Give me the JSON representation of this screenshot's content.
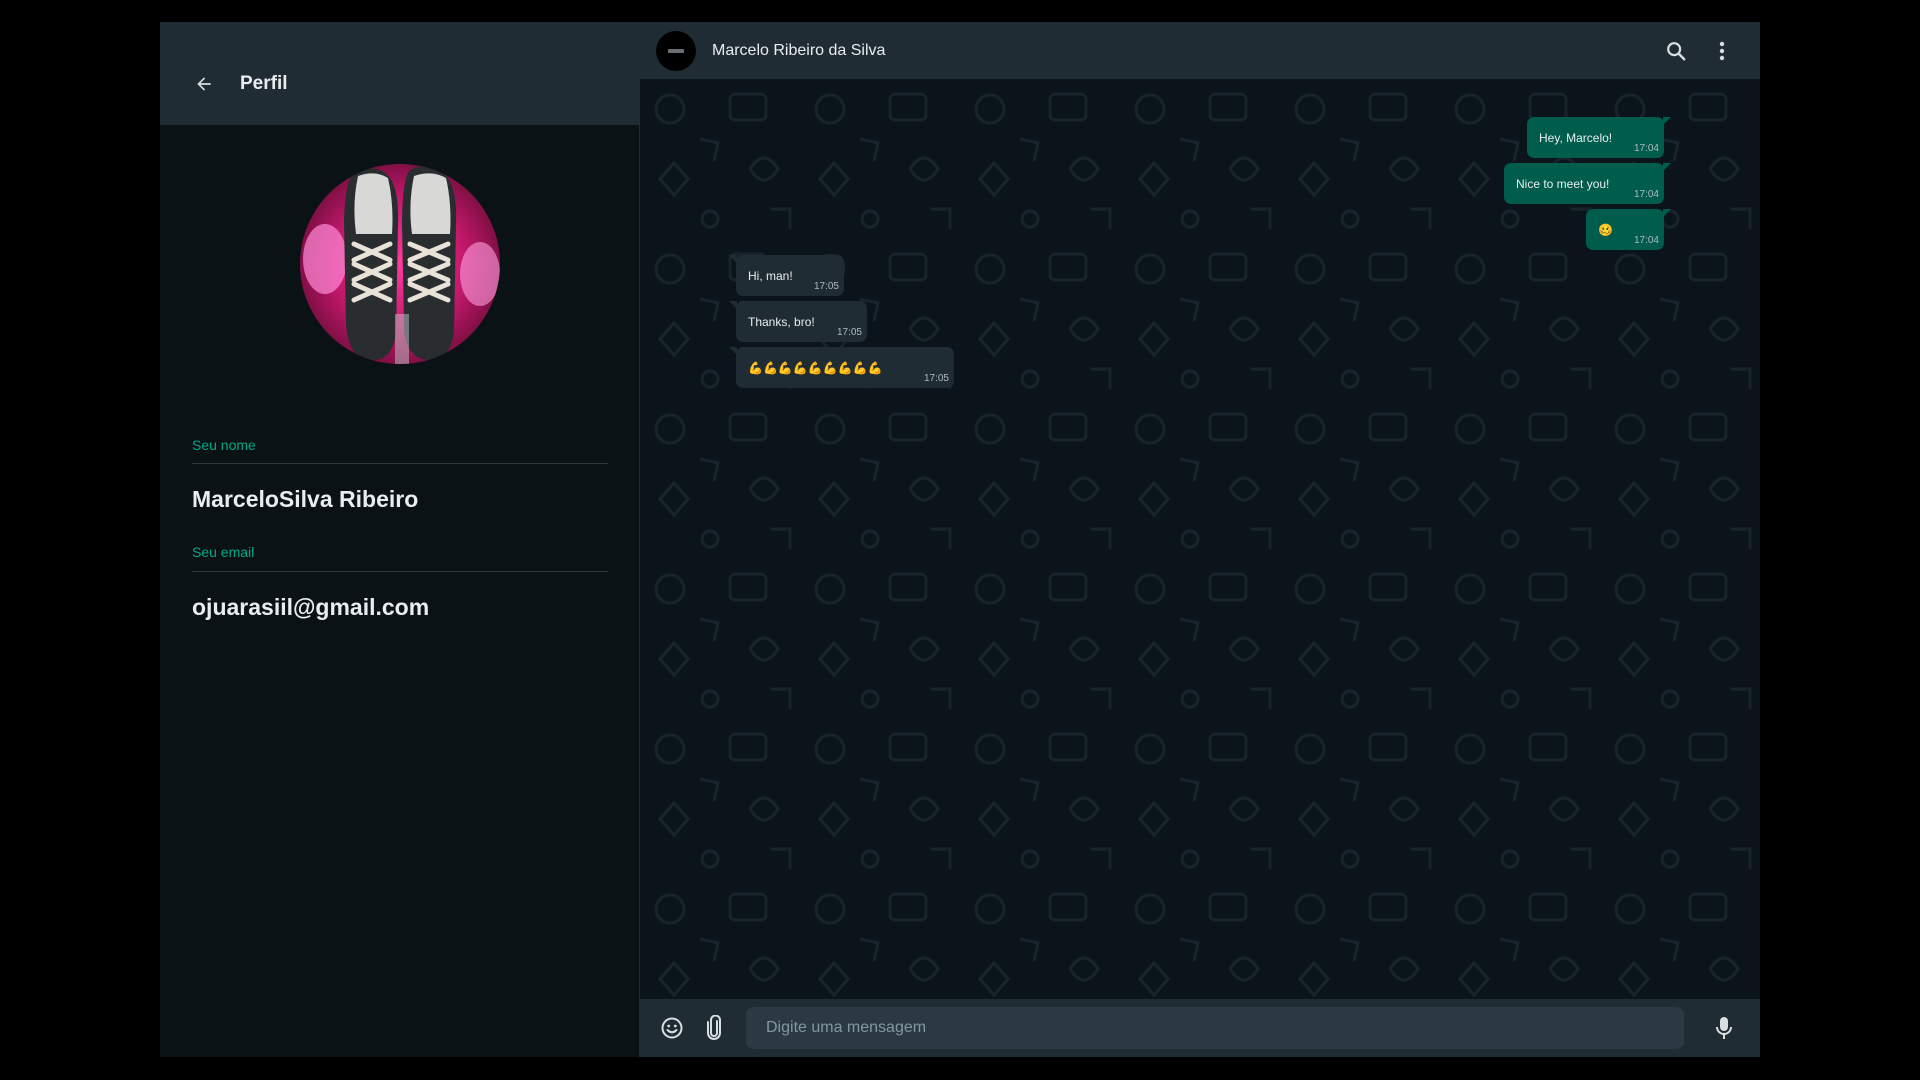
{
  "profile": {
    "title": "Perfil",
    "name_label": "Seu nome",
    "name_value": "MarceloSilva Ribeiro",
    "email_label": "Seu email",
    "email_value": "ojuarasiil@gmail.com",
    "back_icon": "arrow-left-icon",
    "avatar_desc": "sneakers-photo"
  },
  "chat": {
    "contact_name": "Marcelo Ribeiro da Silva",
    "icons": {
      "search": "search-icon",
      "menu": "kebab-menu-icon"
    },
    "messages": [
      {
        "direction": "out",
        "text": "Hey, Marcelo!",
        "time": "17:04"
      },
      {
        "direction": "out",
        "text": "Nice to meet you!",
        "time": "17:04"
      },
      {
        "direction": "out",
        "text": "🥴",
        "time": "17:04"
      },
      {
        "direction": "in",
        "text": "Hi, man!",
        "time": "17:05"
      },
      {
        "direction": "in",
        "text": "Thanks, bro!",
        "time": "17:05"
      },
      {
        "direction": "in",
        "text": "💪💪💪💪💪💪💪💪💪",
        "time": "17:05"
      }
    ]
  },
  "footer": {
    "placeholder": "Digite uma mensagem",
    "icons": {
      "emoji": "emoji-icon",
      "attach": "paperclip-icon",
      "mic": "microphone-icon"
    }
  },
  "colors": {
    "accent": "#00a884",
    "outgoing_bubble": "#005c4b",
    "incoming_bubble": "#202c33",
    "panel_header": "#202c33",
    "background": "#0b141a"
  }
}
